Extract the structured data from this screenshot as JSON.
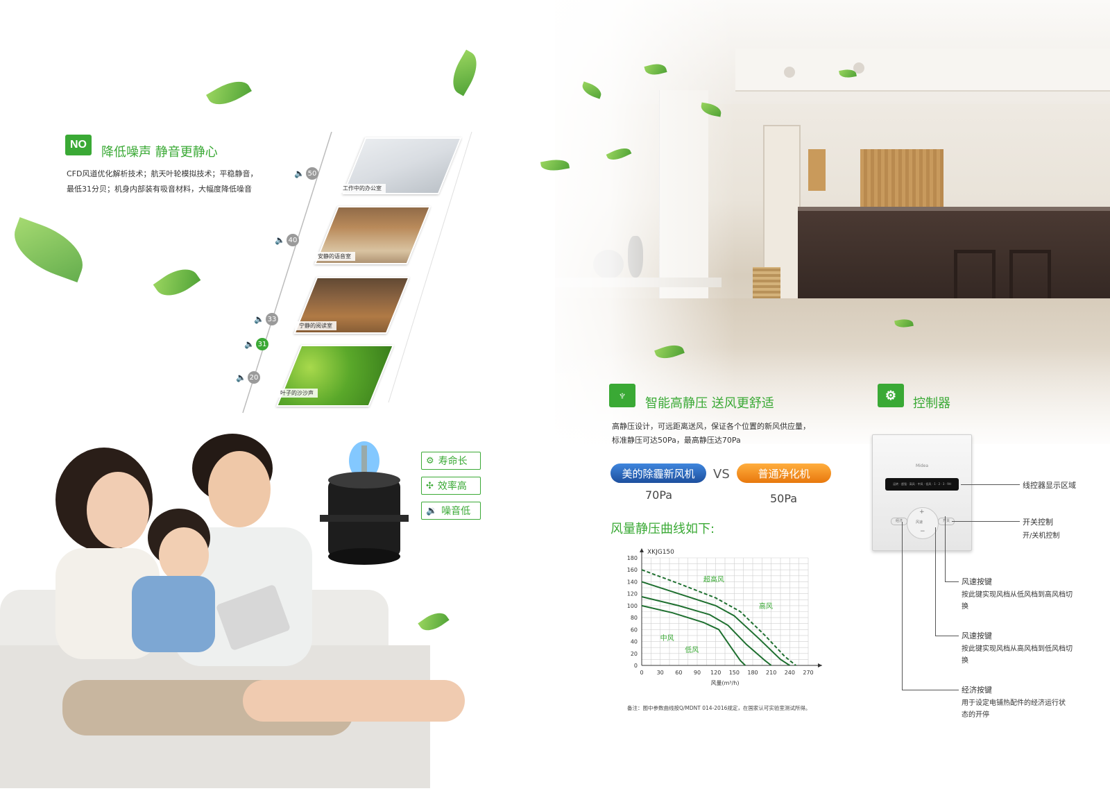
{
  "noise_section": {
    "badge": "NO",
    "title": "降低噪声  静音更静心",
    "body_line1": "CFD风道优化解析技术；航天叶轮模拟技术；平稳静音，",
    "body_line2": "最低31分贝；机身内部装有吸音材料，大幅度降低噪音",
    "levels": [
      {
        "db": "50",
        "caption": "工作中的办公室",
        "active": false
      },
      {
        "db": "40",
        "caption": "安静的语音室",
        "active": false
      },
      {
        "db": "33",
        "caption": "宁静的阅读室",
        "active": false
      },
      {
        "db": "31",
        "caption": "",
        "active": true
      },
      {
        "db": "20",
        "caption": "叶子的沙沙声",
        "active": false
      }
    ]
  },
  "motor_features": [
    {
      "icon": "gear-icon",
      "label": "寿命长"
    },
    {
      "icon": "fan-icon",
      "label": "效率高"
    },
    {
      "icon": "speaker-icon",
      "label": "噪音低"
    }
  ],
  "pressure_section": {
    "title": "智能高静压  送风更舒适",
    "body_line1": "高静压设计，可远距离送风，保证各个位置的新风供应量，",
    "body_line2": "标准静压可达50Pa，最高静压达70Pa",
    "pill_left": "美的除霾新风机",
    "vs": "VS",
    "pill_right": "普通净化机",
    "left_value": "70Pa",
    "right_value": "50Pa",
    "curve_heading": "风量静压曲线如下:",
    "note": "备注：图中参数曲线按Q/MDNT 014-2016规定，在国家认可实验室测试所得。"
  },
  "chart_data": {
    "type": "line",
    "title": "XKJG150",
    "xlabel": "风量(m³/h)",
    "ylabel": "",
    "xlim": [
      0,
      270
    ],
    "ylim": [
      0,
      180
    ],
    "x_ticks": [
      0,
      30,
      60,
      90,
      120,
      150,
      180,
      210,
      240,
      270
    ],
    "y_ticks": [
      0,
      20,
      40,
      60,
      80,
      100,
      120,
      140,
      160,
      180
    ],
    "grid": true,
    "series": [
      {
        "name": "超高风",
        "dashed": true,
        "x": [
          0,
          60,
          120,
          160,
          200,
          232,
          250
        ],
        "y": [
          160,
          137,
          113,
          90,
          50,
          15,
          0
        ]
      },
      {
        "name": "高风",
        "dashed": false,
        "x": [
          0,
          60,
          120,
          150,
          190,
          225,
          240
        ],
        "y": [
          140,
          120,
          100,
          83,
          45,
          10,
          0
        ]
      },
      {
        "name": "中风",
        "dashed": false,
        "x": [
          0,
          60,
          110,
          140,
          170,
          200,
          210
        ],
        "y": [
          115,
          100,
          85,
          67,
          35,
          8,
          0
        ]
      },
      {
        "name": "低风",
        "dashed": false,
        "x": [
          0,
          50,
          100,
          125,
          145,
          160,
          168
        ],
        "y": [
          100,
          88,
          72,
          60,
          30,
          8,
          0
        ]
      }
    ]
  },
  "controller_section": {
    "title": "控制器",
    "brand": "Midea",
    "screen_text": "运转 · 超强 · 高风 · 中风 · 低风 · 1 · 2 · 3 · 9H",
    "btn_economy": "经济",
    "btn_power": "开关",
    "btn_center": "风速",
    "callouts": {
      "display": "线控器显示区域",
      "power_title": "开关控制",
      "power_desc": "开/关机控制",
      "speed_up_title": "风速按键",
      "speed_up_desc": "按此键实现风档从低风档到高风档切换",
      "speed_down_title": "风速按键",
      "speed_down_desc": "按此键实现风档从高风档到低风档切换",
      "eco_title": "经济按键",
      "eco_desc": "用于设定电铺热配件的经济运行状态的开停"
    }
  },
  "colors": {
    "accent_green": "#3aa935",
    "chart_green": "#1e6f2f",
    "pill_blue": "#1f5fb8",
    "pill_orange": "#f08a1c"
  }
}
